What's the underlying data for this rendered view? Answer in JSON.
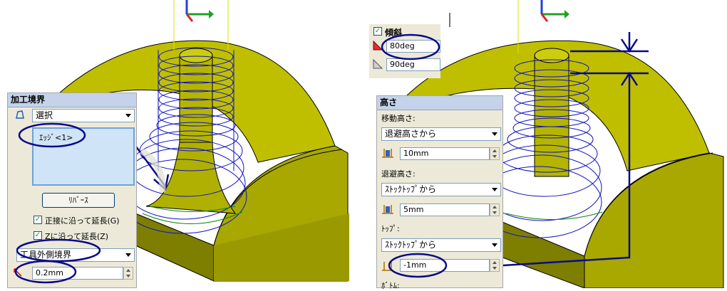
{
  "colors": {
    "model_face": "#bfbf00",
    "model_side": "#7e7e00",
    "toolpath": "#1010c0",
    "annotation": "#0a0a8a",
    "panel_bg": "#ece9d8",
    "panel_title_bg": "#c4d3ea",
    "selection_box": "#cfe4f7"
  },
  "left_panel": {
    "title": "加工境界",
    "boundary_icon": "boundary-shape-icon",
    "select_combo": "選択",
    "edge_item": "ｴｯｼﾞ<1>",
    "reverse_button": "ﾘﾊﾞｰｽ",
    "tangent_extend": {
      "label": "正接に沿って延長(G)",
      "checked": true
    },
    "z_extend": {
      "label": "Zに沿って延長(Z)",
      "checked": true
    },
    "boundary_type_combo": "工具外側境界",
    "offset_value": "0.2mm"
  },
  "slope_panel": {
    "title": "傾斜",
    "checked": true,
    "angle1": "80deg",
    "angle2": "90deg"
  },
  "height_panel": {
    "title": "高さ",
    "move_height_label": "移動高さ:",
    "move_height_combo": "退避高さから",
    "move_height_value": "10mm",
    "retract_height_label": "退避高さ:",
    "retract_height_combo": "ｽﾄｯｸﾄｯﾌﾟから",
    "retract_height_value": "5mm",
    "top_label": "ﾄｯﾌﾟ:",
    "top_combo": "ｽﾄｯｸﾄｯﾌﾟから",
    "top_value": "-1mm",
    "bottom_label": "ﾎﾞﾄﾑ:"
  }
}
